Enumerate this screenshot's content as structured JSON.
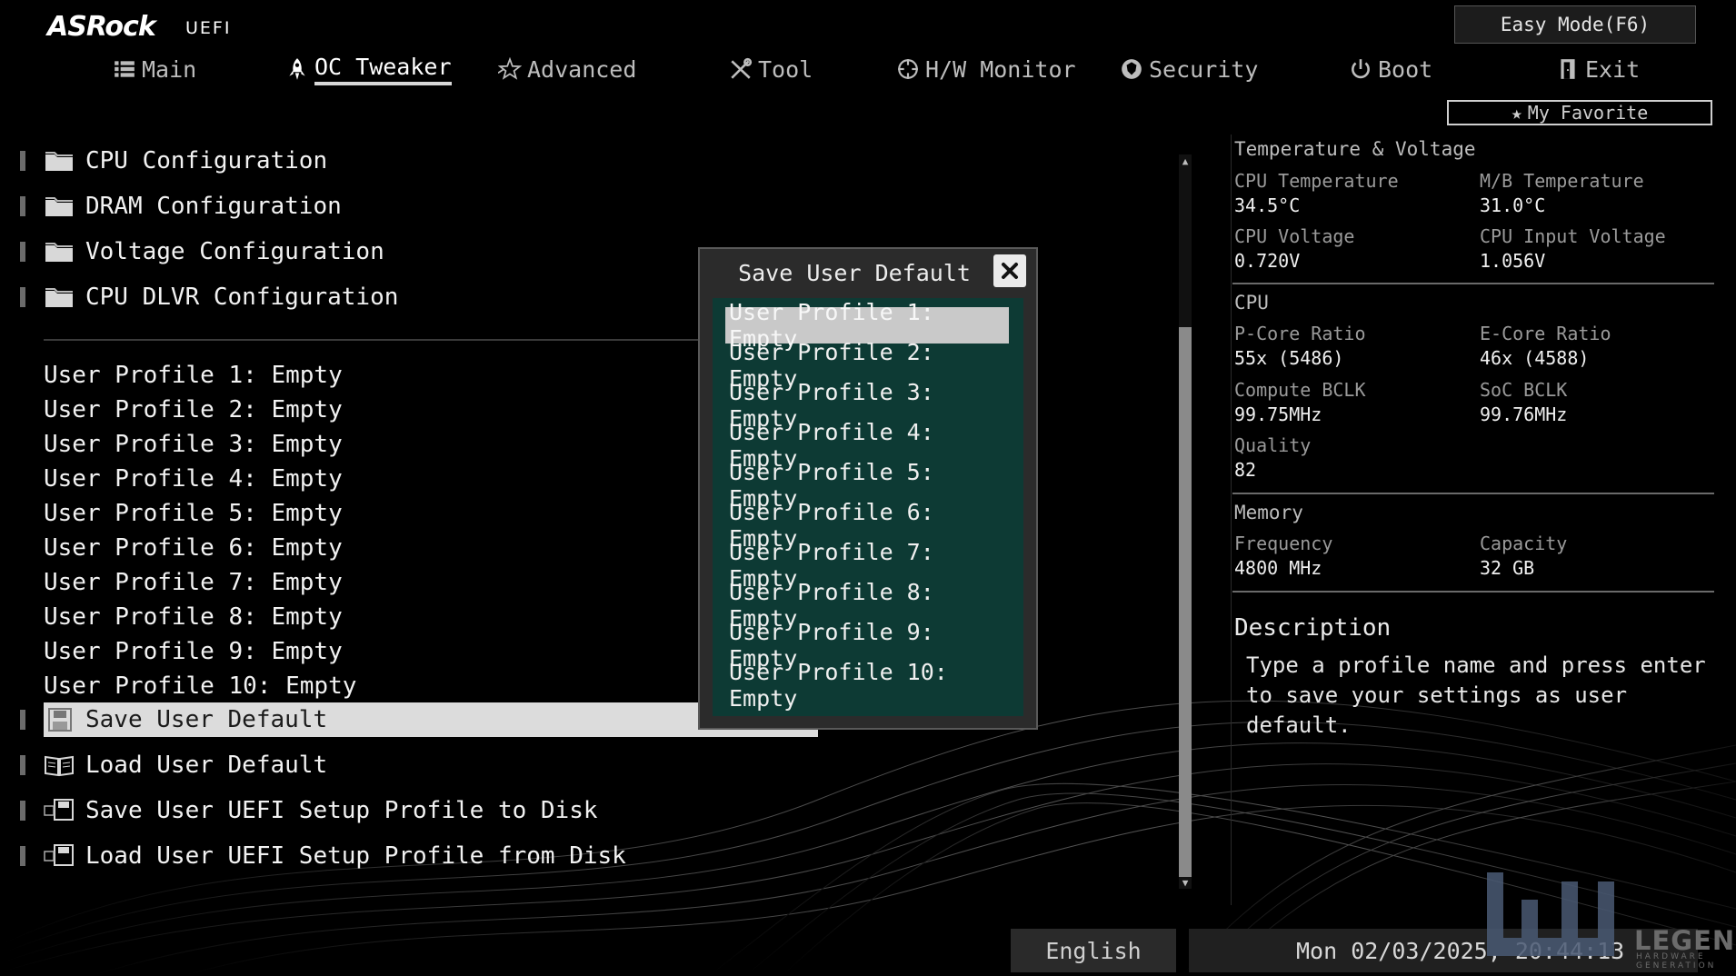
{
  "brand": {
    "logo": "ASRock",
    "sub": "UEFI"
  },
  "header": {
    "easy_mode": "Easy Mode(F6)",
    "my_favorite": "My Favorite"
  },
  "tabs": [
    {
      "label": "Main",
      "icon": "list-icon"
    },
    {
      "label": "OC Tweaker",
      "icon": "rocket-icon",
      "active": true
    },
    {
      "label": "Advanced",
      "icon": "star-icon"
    },
    {
      "label": "Tool",
      "icon": "tools-icon"
    },
    {
      "label": "H/W Monitor",
      "icon": "monitor-icon"
    },
    {
      "label": "Security",
      "icon": "shield-icon"
    },
    {
      "label": "Boot",
      "icon": "power-icon"
    },
    {
      "label": "Exit",
      "icon": "exit-icon"
    }
  ],
  "config_menu": [
    "CPU Configuration",
    "DRAM Configuration",
    "Voltage Configuration",
    "CPU DLVR Configuration"
  ],
  "profiles": [
    "User Profile 1: Empty",
    "User Profile 2: Empty",
    "User Profile 3: Empty",
    "User Profile 4: Empty",
    "User Profile 5: Empty",
    "User Profile 6: Empty",
    "User Profile 7: Empty",
    "User Profile 8: Empty",
    "User Profile 9: Empty",
    "User Profile 10: Empty"
  ],
  "actions": [
    "Save User Default",
    "Load User Default",
    "Save User UEFI Setup Profile to Disk",
    "Load User UEFI Setup Profile from Disk"
  ],
  "dialog": {
    "title": "Save User Default",
    "items": [
      "User Profile 1: Empty",
      "User Profile 2: Empty",
      "User Profile 3: Empty",
      "User Profile 4: Empty",
      "User Profile 5: Empty",
      "User Profile 6: Empty",
      "User Profile 7: Empty",
      "User Profile 8: Empty",
      "User Profile 9: Empty",
      "User Profile 10: Empty"
    ]
  },
  "panel": {
    "temp_voltage": {
      "title": "Temperature & Voltage",
      "cpu_temp_label": "CPU Temperature",
      "cpu_temp": "34.5°C",
      "mb_temp_label": "M/B Temperature",
      "mb_temp": "31.0°C",
      "cpu_volt_label": "CPU Voltage",
      "cpu_volt": "0.720V",
      "cpu_in_volt_label": "CPU Input Voltage",
      "cpu_in_volt": "1.056V"
    },
    "cpu": {
      "title": "CPU",
      "pcore_label": "P-Core Ratio",
      "pcore": "55x (5486)",
      "ecore_label": "E-Core Ratio",
      "ecore": "46x (4588)",
      "bclk_label": "Compute BCLK",
      "bclk": "99.75MHz",
      "soc_label": "SoC BCLK",
      "soc": "99.76MHz",
      "quality_label": "Quality",
      "quality": "82"
    },
    "memory": {
      "title": "Memory",
      "freq_label": "Frequency",
      "freq": "4800 MHz",
      "cap_label": "Capacity",
      "cap": "32 GB"
    },
    "description": {
      "title": "Description",
      "text": "Type a profile name and press enter to save your settings as user default."
    }
  },
  "footer": {
    "language": "English",
    "datetime": "Mon 02/03/2025, 20:44:13"
  },
  "watermark": {
    "text": "LEGEND",
    "sub": "HARDWARE GENERATION"
  }
}
